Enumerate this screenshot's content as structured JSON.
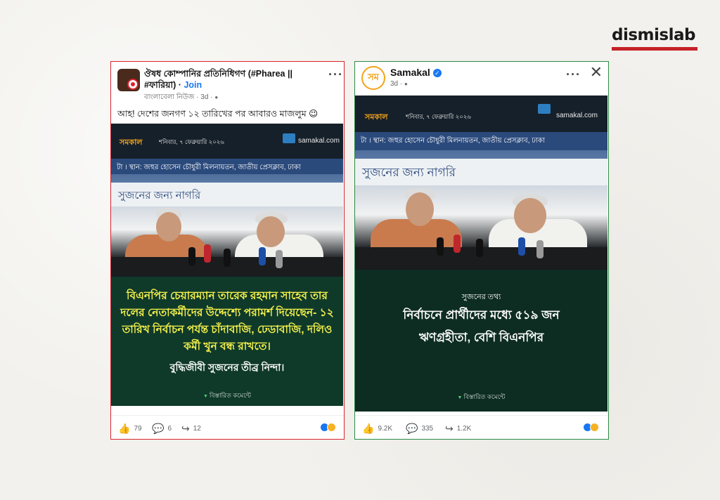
{
  "brand": {
    "logo_text": "dismislab",
    "accent": "#c62027"
  },
  "left_post": {
    "border_color": "#d9232d",
    "group_name": "ঔষধ কোম্পানির প্রতিনিধিগণ (#Pharea || #ফারিয়া)",
    "join_separator": " · ",
    "join_label": "Join",
    "author": "বাংলাবেলা নিউজ",
    "time": "3d",
    "more_icon": "more-dots-icon",
    "caption": "আহ! দেশের জনগণ ১২ তারিখের পর আবারও মাজলুম 😉",
    "media": {
      "brand": "সমকাল",
      "date": "শনিবার, ৭ ফেব্রুয়ারি ২০২৬",
      "site": "samakal.com",
      "banner_line": "টা । স্থান: জহুর হোসেন চৌধুরী মিলনায়তন, জাতীয় প্রেসক্লাব, ঢাকা",
      "banner_title": "সুজনের জন্য নাগরি",
      "quote": "বিএনপির চেয়ারম্যান তারেক রহমান সাহেব তার দলের নেতাকর্মীদের উদ্দেশ্যে পরামর্শ দিয়েছেন- ১২ তারিখ নির্বাচন পর্যন্ত চাঁদাবাজি, ঢেডাবাজি, দলিও কর্মী খুন বন্ধ রাখতে।",
      "subline": "বুদ্ধিজীবী সুজনের তীব্র নিন্দা।",
      "detail": "বিস্তারিত কমেন্টে"
    },
    "reactions": {
      "likes": "79",
      "comments": "6",
      "shares": "12"
    }
  },
  "right_post": {
    "border_color": "#2c8a47",
    "page_name": "Samakal",
    "verified_glyph": "✓",
    "time": "3d",
    "more_icon": "more-dots-icon",
    "close_glyph": "✕",
    "media": {
      "brand": "সমকাল",
      "date": "শনিবার, ৭ ফেব্রুয়ারি ২০২৬",
      "site": "samakal.com",
      "banner_line": "টা । স্থান: জহুর হোসেন চৌধুরী মিলনায়তন, জাতীয় প্রেসক্লাব, ঢাকা",
      "banner_title": "সুজনের জন্য নাগরি",
      "kicker": "সুজনের তথ্য",
      "headline_1": "নির্বাচনে প্রার্থীদের মধ্যে ৫১৯ জন",
      "headline_2": "ঋণগ্রহীতা, বেশি বিএনপির",
      "detail": "বিস্তারিত কমেন্টে"
    },
    "reactions": {
      "likes": "9.2K",
      "comments": "335",
      "shares": "1.2K"
    }
  },
  "icons": {
    "like": "👍",
    "comment": "💬",
    "share": "↪",
    "globe": "🌐"
  }
}
